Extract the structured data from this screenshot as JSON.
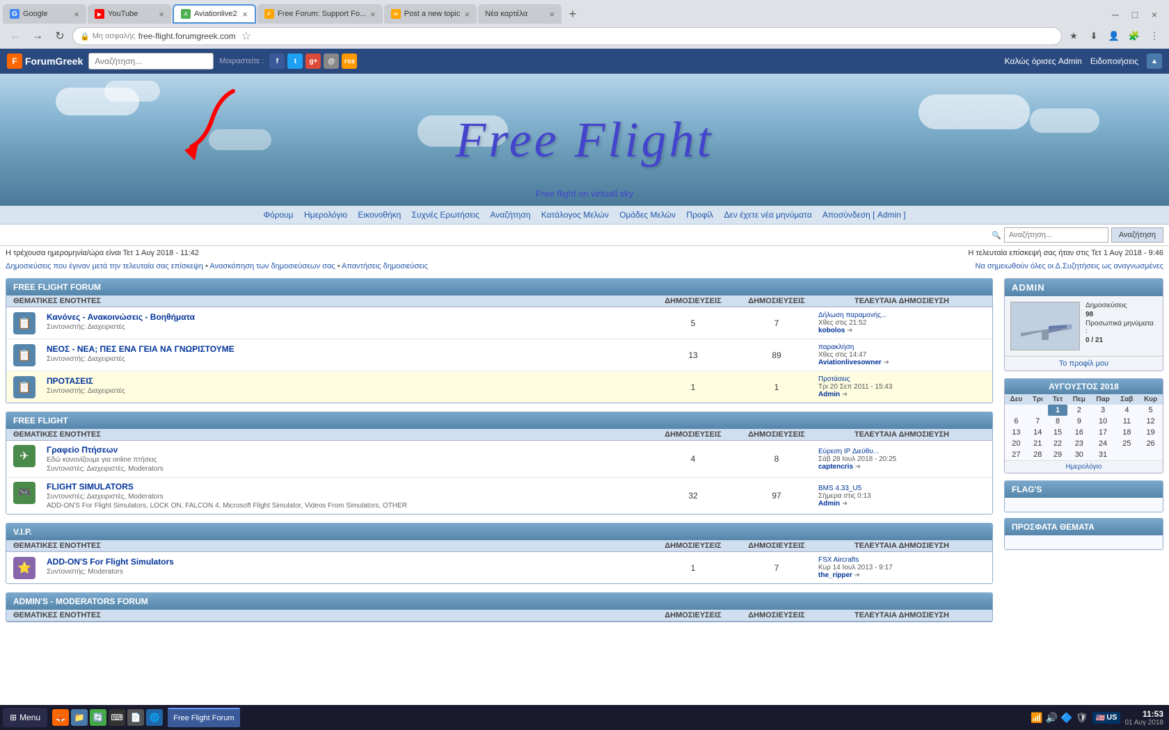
{
  "browser": {
    "tabs": [
      {
        "id": "google",
        "label": "Google",
        "type": "google",
        "active": false
      },
      {
        "id": "youtube",
        "label": "YouTube",
        "type": "youtube",
        "active": false
      },
      {
        "id": "aviationlive",
        "label": "Aviationlive2",
        "type": "aviation",
        "active": true
      },
      {
        "id": "freeflight",
        "label": "Free Forum: Support Fo...",
        "type": "forum",
        "active": false
      },
      {
        "id": "posttopic",
        "label": "Post a new topic",
        "type": "forum",
        "active": false
      },
      {
        "id": "neakartela",
        "label": "Νέα καρτέλα",
        "type": "new",
        "active": false
      }
    ],
    "url": "free-flight.forumgreek.com",
    "secure_label": "Μη ασφαλής"
  },
  "forum_toolbar": {
    "logo": "ForumGreek",
    "search_placeholder": "Αναζήτηση...",
    "label_share": "Μοιραστείτε :",
    "right_links": {
      "welcome": "Καλώς όρισες Admin",
      "notifications": "Ειδοποιήσεις"
    }
  },
  "banner": {
    "title": "Free   Flight",
    "subtitle": "Free flight on virtuall sky"
  },
  "nav_menu": {
    "items": [
      "Φόρουμ",
      "Ημερολόγιο",
      "Εικονοθήκη",
      "Συχνές Ερωτήσεις",
      "Αναζήτηση",
      "Κατάλογος Μελών",
      "Ομάδες Μελών",
      "Προφίλ",
      "Δεν έχετε νέα μηνύματα",
      "Αποσύνδεση [ Admin ]"
    ]
  },
  "search_bar": {
    "placeholder": "Αναζήτηση...",
    "button_label": "Αναζήτηση"
  },
  "info_bar": {
    "current_time": "Η τρέχουσα ημερομηνία/ώρα είναι Τετ 1 Αυγ 2018 - 11:42",
    "last_visit": "Η τελευταία επίσκεψή σας ήταν στις Τετ 1 Αυγ 2018 - 9:46"
  },
  "info_links": {
    "link1": "Δημοσιεύσεις που έγιναν μετά την τελευταία σας επίσκεψη",
    "link2": "Ανασκόπηση των δημοσιεύσεων σας",
    "link3": "Απαντήσεις δημοσιεύσεις",
    "right_link": "Να σημειωθούν όλες οι Δ.Συζητήσεις ως αναγνωσμένες"
  },
  "sections": [
    {
      "id": "free-flight-forum",
      "title": "FREE FLIGHT FORUM",
      "cols": [
        "ΘΕΜΑΤΙΚΕΣ ΕΝΟΤΗΤΕΣ",
        "ΔΗΜΟΣΙΕΥΣΕΙΣ",
        "ΤΕΛΕΥΤΑΙΑ ΔΗΜΟΣΙΕΥΣΗ"
      ],
      "rows": [
        {
          "icon": "📋",
          "title": "Κανόνες - Ανακοινώσεις - Βοηθήματα",
          "sub": "Συντονιστής: Διαχειριστές",
          "topics": "5",
          "posts": "7",
          "last_post_title": "Δήλωση παραμονής...",
          "last_post_time": "Χθες στις 21:52",
          "last_post_author": "kobolos",
          "highlighted": false
        },
        {
          "icon": "📋",
          "title": "ΝΕΟΣ - ΝΕΑ; ΠΕΣ ΕΝΑ ΓΕΙΑ ΝΑ ΓΝΩΡΙΣΤΟΥΜΕ",
          "sub": "Συντονιστής: Διαχειριστές",
          "topics": "13",
          "posts": "89",
          "last_post_title": "παρακλήση",
          "last_post_time": "Χθες στις 14:47",
          "last_post_author": "Aviationlivesowner",
          "highlighted": false
        },
        {
          "icon": "📋",
          "title": "ΠΡΟΤΑΣΕΙΣ",
          "sub": "Συντονιστής: Διαχειριστές",
          "topics": "1",
          "posts": "1",
          "last_post_title": "Προτάσεις",
          "last_post_time": "Τρι 20 Σεπ 2011 - 15:43",
          "last_post_author": "Admin",
          "highlighted": true
        }
      ]
    },
    {
      "id": "free-flight",
      "title": "FREE FLIGHT",
      "cols": [
        "ΘΕΜΑΤΙΚΕΣ ΕΝΟΤΗΤΕΣ",
        "ΔΗΜΟΣΙΕΥΣΕΙΣ",
        "ΤΕΛΕΥΤΑΙΑ ΔΗΜΟΣΙΕΥΣΗ"
      ],
      "rows": [
        {
          "icon": "✈",
          "title": "Γραφείο Πτήσεων",
          "sub_line1": "Εδώ κανονίζουμε για online πτήσεις",
          "sub_line2": "Συντονιστές: Διαχειριστές, Moderators",
          "topics": "4",
          "posts": "8",
          "last_post_title": "Εύρεση IP Διεύθυ...",
          "last_post_time": "Σάβ 28 Ιουλ 2018 - 20:25",
          "last_post_author": "captencris",
          "highlighted": false
        },
        {
          "icon": "🎮",
          "title": "FLIGHT SIMULATORS",
          "sub_line1": "",
          "sub_line2": "Συντονιστές: Διαχειριστές, Moderators",
          "sub_line3": "ADD-ON'S For Flight Simulators, LOCK ON, FALCON 4, Microsoft Flight Simulator, Videos From Simulators, OTHER",
          "topics": "32",
          "posts": "97",
          "last_post_title": "BMS 4.33_U5",
          "last_post_time": "Σήμερα στις 0:13",
          "last_post_author": "Admin",
          "highlighted": false
        }
      ]
    },
    {
      "id": "vip",
      "title": "V.I.P.",
      "cols": [
        "ΘΕΜΑΤΙΚΕΣ ΕΝΟΤΗΤΕΣ",
        "ΔΗΜΟΣΙΕΥΣΕΙΣ",
        "ΤΕΛΕΥΤΑΙΑ ΔΗΜΟΣΙΕΥΣΗ"
      ],
      "rows": [
        {
          "icon": "⭐",
          "title": "ADD-ON'S For Flight Simulators",
          "sub": "Συντονιστής: Moderators",
          "topics": "1",
          "posts": "7",
          "last_post_title": "FSX Aircrafts",
          "last_post_time": "Κυρ 14 Ιουλ 2013 - 9:17",
          "last_post_author": "the_ripper",
          "highlighted": false
        }
      ]
    },
    {
      "id": "admins-mods",
      "title": "ADMIN'S - MODERATORS FORUM",
      "cols": [
        "ΘΕΜΑΤΙΚΕΣ ΕΝΟΤΗΤΕΣ",
        "ΔΗΜΟΣΙΕΥΣΕΙΣ",
        "ΤΕΛΕΥΤΑΙΑ ΔΗΜΟΣΙΕΥΣΗ"
      ],
      "rows": []
    }
  ],
  "sidebar": {
    "admin": {
      "header": "ADMIN",
      "posts_label": "Δημοσιεύσεις",
      "posts_count": "98",
      "private_label": "Προσωπικά μηνύματα :",
      "private_count": "0 / 21",
      "profile_link": "Το προφίλ μου"
    },
    "calendar": {
      "header": "ΑΥΓΟΥΣΤΟΣ 2018",
      "days": [
        "Δευ",
        "Τρι",
        "Τετ",
        "Πεμ",
        "Παρ",
        "Σαβ",
        "Κυρ"
      ],
      "weeks": [
        [
          "",
          "",
          "1",
          "2",
          "3",
          "4",
          "5"
        ],
        [
          "6",
          "7",
          "8",
          "9",
          "10",
          "11",
          "12"
        ],
        [
          "13",
          "14",
          "15",
          "16",
          "17",
          "18",
          "19"
        ],
        [
          "20",
          "21",
          "22",
          "23",
          "24",
          "25",
          "26"
        ],
        [
          "27",
          "28",
          "29",
          "30",
          "31",
          "",
          ""
        ]
      ],
      "today": "1",
      "footer": "Ημερολόγιο"
    },
    "flags": {
      "header": "FLAG'S"
    },
    "recent": {
      "header": "ΠΡΟΣΦΑΤΑ ΘΕΜΑΤΑ"
    }
  },
  "taskbar": {
    "start_label": "Menu",
    "items": [
      {
        "label": "Free Flight Forum",
        "active": true
      }
    ],
    "time": "11:53",
    "date": "01 Αυγ 2018",
    "locale_badge": "US"
  }
}
